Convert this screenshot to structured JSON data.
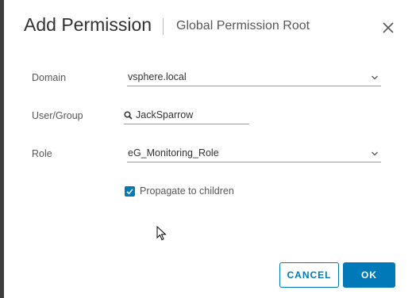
{
  "dialog": {
    "title": "Add Permission",
    "subtitle": "Global Permission Root",
    "close_icon": "close-icon"
  },
  "form": {
    "domain": {
      "label": "Domain",
      "value": "vsphere.local",
      "icon": "chevron-down-icon"
    },
    "user_group": {
      "label": "User/Group",
      "value": "JackSparrow",
      "icon": "search-icon"
    },
    "role": {
      "label": "Role",
      "value": "eG_Monitoring_Role",
      "icon": "chevron-down-icon"
    },
    "propagate": {
      "label": "Propagate to children",
      "checked": true
    }
  },
  "buttons": {
    "cancel_label": "CANCEL",
    "ok_label": "OK"
  },
  "colors": {
    "accent": "#0079b8",
    "text": "#313131",
    "muted": "#565656"
  }
}
